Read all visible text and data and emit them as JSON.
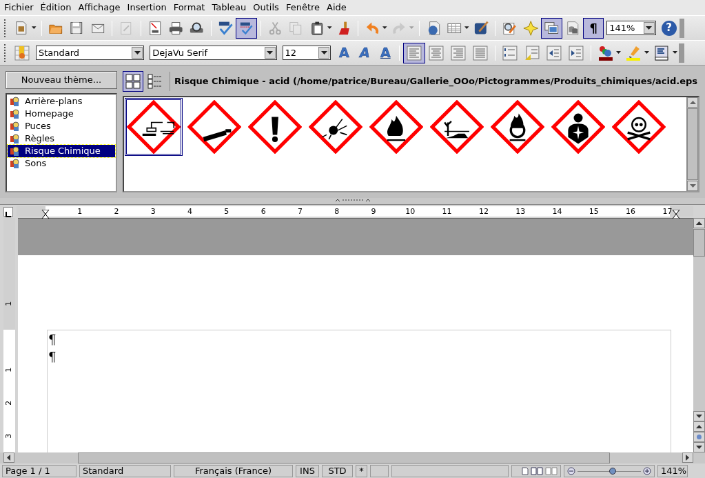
{
  "menu": [
    {
      "label": "Fichier"
    },
    {
      "label": "Édition"
    },
    {
      "label": "Affichage"
    },
    {
      "label": "Insertion"
    },
    {
      "label": "Format"
    },
    {
      "label": "Tableau"
    },
    {
      "label": "Outils"
    },
    {
      "label": "Fenêtre"
    },
    {
      "label": "Aide"
    }
  ],
  "standard_toolbar": [
    [
      {
        "kind": "new",
        "pressed": false,
        "disabled": false,
        "dropdown": true
      }
    ],
    [
      {
        "kind": "open",
        "pressed": false,
        "disabled": false,
        "dropdown": false
      },
      {
        "kind": "save",
        "pressed": false,
        "disabled": false,
        "dropdown": false
      },
      {
        "kind": "mail",
        "pressed": false,
        "disabled": false,
        "dropdown": false
      }
    ],
    [
      {
        "kind": "edit",
        "pressed": false,
        "disabled": true,
        "dropdown": false
      }
    ],
    [
      {
        "kind": "pdf",
        "pressed": false,
        "disabled": false,
        "dropdown": false
      },
      {
        "kind": "print",
        "pressed": false,
        "disabled": false,
        "dropdown": false
      },
      {
        "kind": "preview",
        "pressed": false,
        "disabled": false,
        "dropdown": false
      }
    ],
    [
      {
        "kind": "spell",
        "pressed": false,
        "disabled": false,
        "dropdown": false
      },
      {
        "kind": "autospell",
        "pressed": true,
        "disabled": false,
        "dropdown": false
      }
    ],
    [
      {
        "kind": "cut",
        "pressed": false,
        "disabled": true,
        "dropdown": false
      },
      {
        "kind": "copy",
        "pressed": false,
        "disabled": true,
        "dropdown": false
      },
      {
        "kind": "paste",
        "pressed": false,
        "disabled": false,
        "dropdown": true
      },
      {
        "kind": "brush",
        "pressed": false,
        "disabled": false,
        "dropdown": false
      }
    ],
    [
      {
        "kind": "undo",
        "pressed": false,
        "disabled": false,
        "dropdown": true
      },
      {
        "kind": "redo",
        "pressed": false,
        "disabled": true,
        "dropdown": true
      }
    ],
    [
      {
        "kind": "hyperlink",
        "pressed": false,
        "disabled": false,
        "dropdown": false
      },
      {
        "kind": "table",
        "pressed": false,
        "disabled": false,
        "dropdown": true
      },
      {
        "kind": "draw",
        "pressed": false,
        "disabled": false,
        "dropdown": false
      }
    ],
    [
      {
        "kind": "find",
        "pressed": false,
        "disabled": false,
        "dropdown": false
      },
      {
        "kind": "navigator",
        "pressed": false,
        "disabled": false,
        "dropdown": false
      },
      {
        "kind": "gallery",
        "pressed": true,
        "disabled": false,
        "dropdown": false
      },
      {
        "kind": "datasource",
        "pressed": false,
        "disabled": false,
        "dropdown": false
      },
      {
        "kind": "marks",
        "label": "¶",
        "pressed": true,
        "disabled": false,
        "dropdown": false
      },
      {
        "kind": "zoom",
        "value": "141%"
      },
      {
        "kind": "help",
        "label": "?",
        "pressed": false,
        "disabled": false,
        "dropdown": false
      }
    ]
  ],
  "formatting_toolbar": [
    [
      {
        "kind": "styles",
        "pressed": false,
        "dropdown": false
      },
      {
        "kind": "style",
        "value": "Standard"
      },
      {
        "kind": "font",
        "value": "DejaVu Serif"
      },
      {
        "kind": "size",
        "value": "12"
      },
      {
        "kind": "bold",
        "label": "A",
        "pressed": false,
        "dropdown": false
      },
      {
        "kind": "italic",
        "label": "A",
        "pressed": false,
        "dropdown": false
      },
      {
        "kind": "underline",
        "label": "A",
        "pressed": false,
        "dropdown": false
      }
    ],
    [
      {
        "kind": "align-left",
        "pressed": true,
        "dropdown": false
      },
      {
        "kind": "align-center",
        "pressed": false,
        "dropdown": false
      },
      {
        "kind": "align-right",
        "pressed": false,
        "dropdown": false
      },
      {
        "kind": "justify",
        "pressed": false,
        "dropdown": false
      }
    ],
    [
      {
        "kind": "numbering",
        "pressed": false,
        "dropdown": false
      },
      {
        "kind": "bullets",
        "pressed": false,
        "dropdown": false
      },
      {
        "kind": "outdent",
        "pressed": false,
        "dropdown": false
      },
      {
        "kind": "indent",
        "pressed": false,
        "dropdown": false
      }
    ],
    [
      {
        "kind": "font-color",
        "pressed": false,
        "dropdown": true
      },
      {
        "kind": "highlight",
        "pressed": false,
        "dropdown": true
      },
      {
        "kind": "background",
        "pressed": false,
        "dropdown": true
      }
    ]
  ],
  "gallery": {
    "new_theme_button": "Nouveau thème...",
    "themes": [
      {
        "label": "Arrière-plans",
        "selected": false
      },
      {
        "label": "Homepage",
        "selected": false
      },
      {
        "label": "Puces",
        "selected": false
      },
      {
        "label": "Règles",
        "selected": false
      },
      {
        "label": "Risque Chimique",
        "selected": true
      },
      {
        "label": "Sons",
        "selected": false
      }
    ],
    "views": [
      {
        "kind": "icons",
        "selected": true
      },
      {
        "kind": "details",
        "selected": false
      }
    ],
    "title": "Risque Chimique - acid (/home/patrice/Bureau/Gallerie_OOo/Pictogrammes/Produits_chimiques/acid.eps",
    "items": [
      {
        "kind": "corrosive",
        "selected": true
      },
      {
        "kind": "gas-cylinder",
        "selected": false
      },
      {
        "kind": "exclamation",
        "selected": false
      },
      {
        "kind": "explosive",
        "selected": false
      },
      {
        "kind": "flame",
        "selected": false
      },
      {
        "kind": "environment",
        "selected": false
      },
      {
        "kind": "oxidizer",
        "selected": false
      },
      {
        "kind": "health-hazard",
        "selected": false
      },
      {
        "kind": "skull",
        "selected": false
      }
    ]
  },
  "ruler": {
    "numbers": [
      "1",
      "2",
      "3",
      "4",
      "5",
      "6",
      "7",
      "8",
      "9",
      "10",
      "11",
      "12",
      "13",
      "14",
      "15",
      "16",
      "17"
    ]
  },
  "vertical_ruler": {
    "top_margin_numbers": [
      "1"
    ],
    "numbers": [
      "1",
      "2",
      "3"
    ]
  },
  "document": {
    "paragraph_marks": [
      "¶",
      "¶"
    ]
  },
  "status_bar": {
    "page": "Page 1 / 1",
    "style": "Standard",
    "language": "Français (France)",
    "insert_mode": "INS",
    "selection_mode": "STD",
    "modified": "*",
    "zoom_slider": {
      "level": 0.55
    },
    "zoom": "141%"
  }
}
